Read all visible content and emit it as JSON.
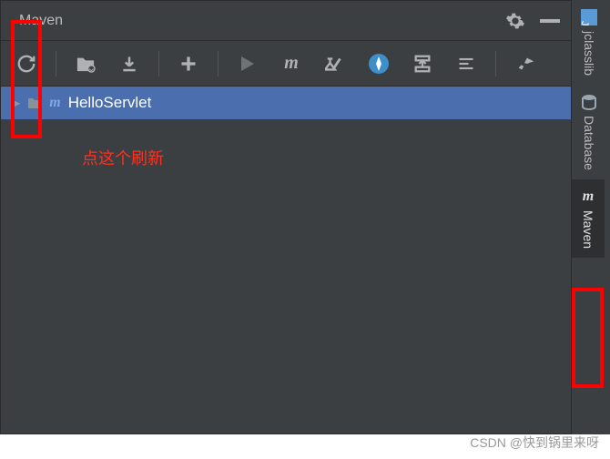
{
  "title": "Maven",
  "toolbar": {
    "tooltips": {
      "reload": "Reload",
      "generate_sources": "Generate Sources",
      "download": "Download Sources",
      "add": "Add Maven Project",
      "run": "Run Configuration",
      "m": "Execute Maven Goal",
      "toggle_skip": "Toggle Skip Tests",
      "offline": "Toggle Offline",
      "dependencies": "Show Dependencies",
      "collapse": "Collapse All",
      "settings": "Settings"
    }
  },
  "tree": {
    "project_name": "HelloServlet"
  },
  "annotation": "点这个刷新",
  "sidebar": {
    "tabs": [
      {
        "label": "jclasslib"
      },
      {
        "label": "Database"
      },
      {
        "label": "Maven"
      }
    ]
  },
  "watermark": "CSDN @快到锅里来呀"
}
